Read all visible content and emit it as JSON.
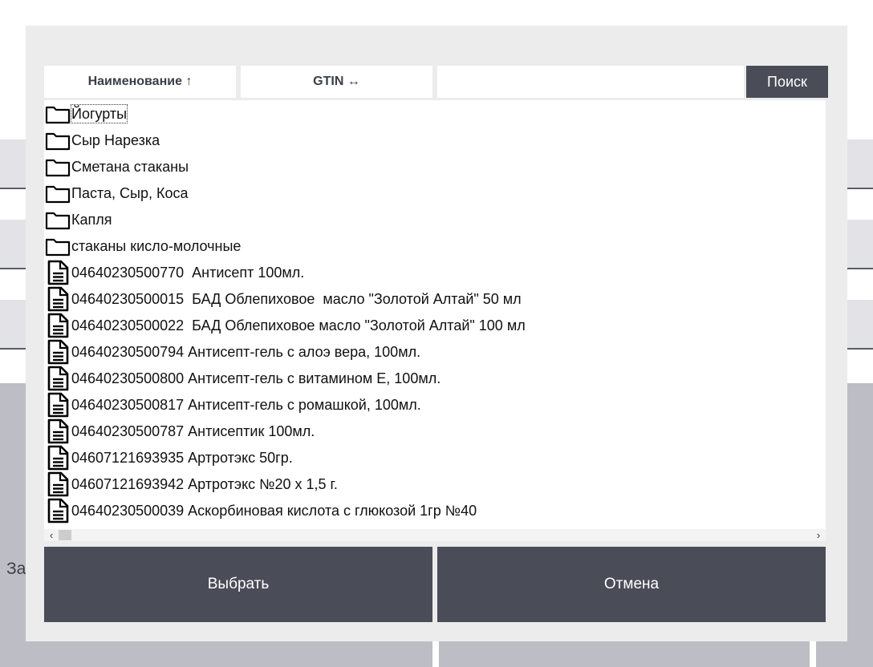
{
  "background": {
    "partial_label": "За"
  },
  "dialog": {
    "sort_name_label": "Наименование ↑",
    "sort_gtin_label": "GTIN ↔",
    "search_value": "",
    "search_button": "Поиск",
    "items": [
      {
        "type": "folder",
        "label": "Йогурты"
      },
      {
        "type": "folder",
        "label": "Сыр Нарезка"
      },
      {
        "type": "folder",
        "label": "Сметана стаканы"
      },
      {
        "type": "folder",
        "label": "Паста, Сыр, Коса"
      },
      {
        "type": "folder",
        "label": "Капля"
      },
      {
        "type": "folder",
        "label": "стаканы кисло-молочные"
      },
      {
        "type": "document",
        "label": "04640230500770  Антисепт 100мл."
      },
      {
        "type": "document",
        "label": "04640230500015  БАД Облепиховое  масло \"Золотой Алтай\" 50 мл"
      },
      {
        "type": "document",
        "label": "04640230500022  БАД Облепиховое масло \"Золотой Алтай\" 100 мл"
      },
      {
        "type": "document",
        "label": "04640230500794 Антисепт-гель с алоэ вера, 100мл."
      },
      {
        "type": "document",
        "label": "04640230500800 Антисепт-гель с витамином Е, 100мл."
      },
      {
        "type": "document",
        "label": "04640230500817 Антисепт-гель с ромашкой, 100мл."
      },
      {
        "type": "document",
        "label": "04640230500787 Антисептик 100мл."
      },
      {
        "type": "document",
        "label": "04607121693935 Артротэкс 50гр."
      },
      {
        "type": "document",
        "label": "04607121693942 Артротэкс №20 х 1,5 г."
      },
      {
        "type": "document",
        "label": "04640230500039 Аскорбиновая кислота с глюкозой 1гр №40"
      }
    ],
    "scroll_left_arrow": "‹",
    "scroll_right_arrow": "›",
    "select_button": "Выбрать",
    "cancel_button": "Отмена"
  }
}
